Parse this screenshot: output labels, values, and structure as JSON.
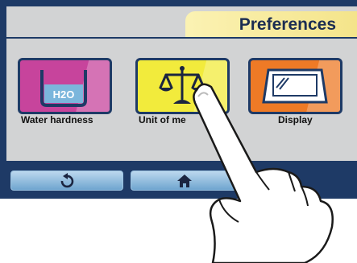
{
  "header": {
    "title": "Preferences"
  },
  "tiles": [
    {
      "label": "Water hardness",
      "icon": "water-glass-icon",
      "icon_text": "H2O",
      "color": "#c7449c"
    },
    {
      "label": "Unit of me",
      "icon": "balance-scale-icon",
      "color": "#f2eb3c"
    },
    {
      "label": "Display",
      "icon": "display-screen-icon",
      "color": "#ee7a26"
    }
  ],
  "footer": {
    "buttons": [
      {
        "name": "back",
        "icon": "back-arrow-icon"
      },
      {
        "name": "home",
        "icon": "home-icon"
      }
    ]
  },
  "colors": {
    "frame": "#1e3a66",
    "screen": "#d2d3d4",
    "title_tab": "#f4e48a",
    "button": "#6fa5cf"
  }
}
